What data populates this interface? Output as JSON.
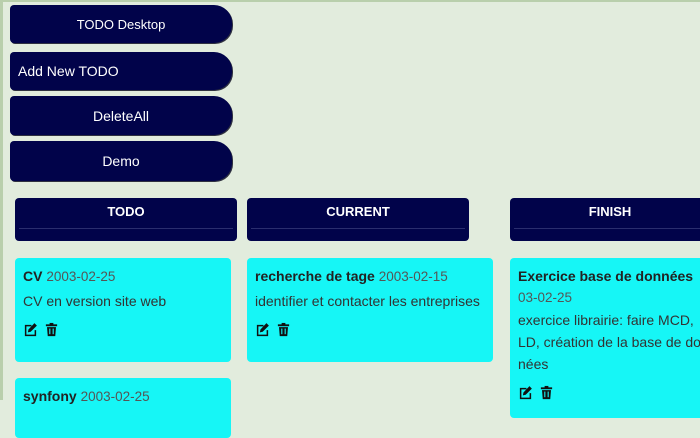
{
  "nav": {
    "title": "TODO Desktop",
    "add_label": "Add New TODO",
    "delete_all_label": "DeleteAll",
    "demo_label": "Demo"
  },
  "columns": {
    "todo": "TODO",
    "current": "CURRENT",
    "finish": "FINISH"
  },
  "cards": {
    "cv": {
      "title": "CV",
      "date": "2003-02-25",
      "desc": "CV en version site web"
    },
    "symfony": {
      "title": "synfony",
      "date": "2003-02-25"
    },
    "stage": {
      "title": "recherche de tage",
      "date": "2003-02-15",
      "desc": "identifier et contacter les entreprises"
    },
    "exercice": {
      "title": "Exercice base de données",
      "date": "03-02-25",
      "desc_line1": "exercice librairie: faire MCD,",
      "desc_line2": "LD, création de la base de do",
      "desc_line3": "nées"
    }
  },
  "icons": {
    "edit": "edit-icon",
    "delete": "trash-icon"
  },
  "colors": {
    "navy": "#01034a",
    "card": "#16f6f6",
    "background": "#e2ecdd"
  }
}
